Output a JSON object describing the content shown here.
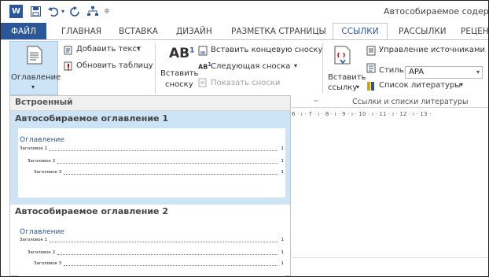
{
  "title_bar": {
    "app_icon": "W",
    "qa_icons": [
      "save-icon",
      "undo-icon",
      "redo-icon",
      "share-icon",
      "customize-icon"
    ],
    "title": "Автособираемое содержан"
  },
  "tabs": [
    {
      "label": "ФАЙЛ"
    },
    {
      "label": "ГЛАВНАЯ"
    },
    {
      "label": "ВСТАВКА"
    },
    {
      "label": "ДИЗАЙН"
    },
    {
      "label": "РАЗМЕТКА СТРАНИЦЫ"
    },
    {
      "label": "ССЫЛКИ"
    },
    {
      "label": "РАССЫЛКИ"
    },
    {
      "label": "РЕЦЕН"
    }
  ],
  "ribbon": {
    "toc_button": "Оглавление",
    "add_text": "Добавить текст",
    "update_table": "Обновить таблицу",
    "insert_footnote_1": "Вставить",
    "insert_footnote_2": "сноску",
    "insert_endnote": "Вставить концевую сноску",
    "next_footnote": "Следующая сноска",
    "show_notes": "Показать сноски",
    "insert_citation_1": "Вставить",
    "insert_citation_2": "ссылку",
    "manage_sources": "Управление источниками",
    "style_label": "Стиль:",
    "style_value": "APA",
    "bibliography": "Список литературы",
    "citations_group": "Ссылки и списки литературы"
  },
  "ruler": "6 · ı · 7 · ı · 8 · ı · 9 · ı · 10 · ı · 11 · ı · 12 · ı · 13 ·",
  "gallery": {
    "header": "Встроенный",
    "items": [
      {
        "title": "Автособираемое оглавление 1",
        "preview_head": "Оглавление",
        "lines": [
          {
            "text": "Заголовок 1",
            "page": "1"
          },
          {
            "text": "Заголовок 2",
            "page": "1"
          },
          {
            "text": "Заголовок 3",
            "page": "1"
          }
        ]
      },
      {
        "title": "Автособираемое оглавление 2",
        "preview_head": "Оглавление",
        "lines": [
          {
            "text": "Заголовок 1",
            "page": "1"
          },
          {
            "text": "Заголовок 2",
            "page": "1"
          },
          {
            "text": "Заголовок 3",
            "page": "1"
          }
        ]
      }
    ]
  },
  "colors": {
    "accent": "#2b579a",
    "selected": "#cde4f7",
    "header_bg": "#f0f0f0"
  }
}
